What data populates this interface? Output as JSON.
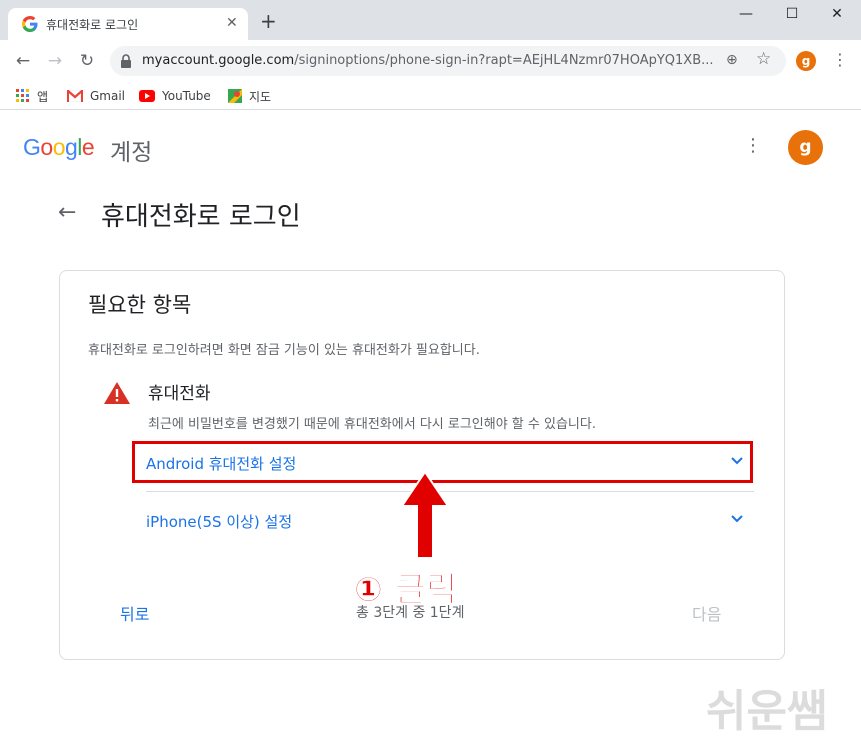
{
  "browser": {
    "tab_title": "휴대전화로 로그인",
    "url_host": "myaccount.google.com",
    "url_path": "/signinoptions/phone-sign-in?rapt=AEjHL4Nzmr07HOApYQ1XB...",
    "profile_initial": "g",
    "bookmarks": [
      {
        "label": "앱",
        "icon": "apps-grid-icon"
      },
      {
        "label": "Gmail",
        "icon": "gmail-icon"
      },
      {
        "label": "YouTube",
        "icon": "youtube-icon"
      },
      {
        "label": "지도",
        "icon": "maps-icon"
      }
    ]
  },
  "header": {
    "logo_text": "Google",
    "logo_suffix": "계정",
    "avatar_initial": "g"
  },
  "main": {
    "title": "휴대전화로 로그인",
    "card": {
      "heading": "필요한 항목",
      "description": "휴대전화로 로그인하려면 화면 잠금 기능이 있는 휴대전화가 필요합니다.",
      "requirement": {
        "title": "휴대전화",
        "description": "최근에 비밀번호를 변경했기 때문에 휴대전화에서 다시 로그인해야 할 수 있습니다."
      },
      "options": [
        {
          "label": "Android 휴대전화 설정"
        },
        {
          "label": "iPhone(5S 이상) 설정"
        }
      ],
      "back_label": "뒤로",
      "step_text": "총 3단계 중 1단계",
      "next_label": "다음"
    }
  },
  "annotation": {
    "label": "① 클릭",
    "color": "#e00000"
  },
  "watermark": "쉬운쌤",
  "colors": {
    "link": "#1a73e8",
    "avatar": "#e8710a",
    "warning": "#d93025"
  }
}
